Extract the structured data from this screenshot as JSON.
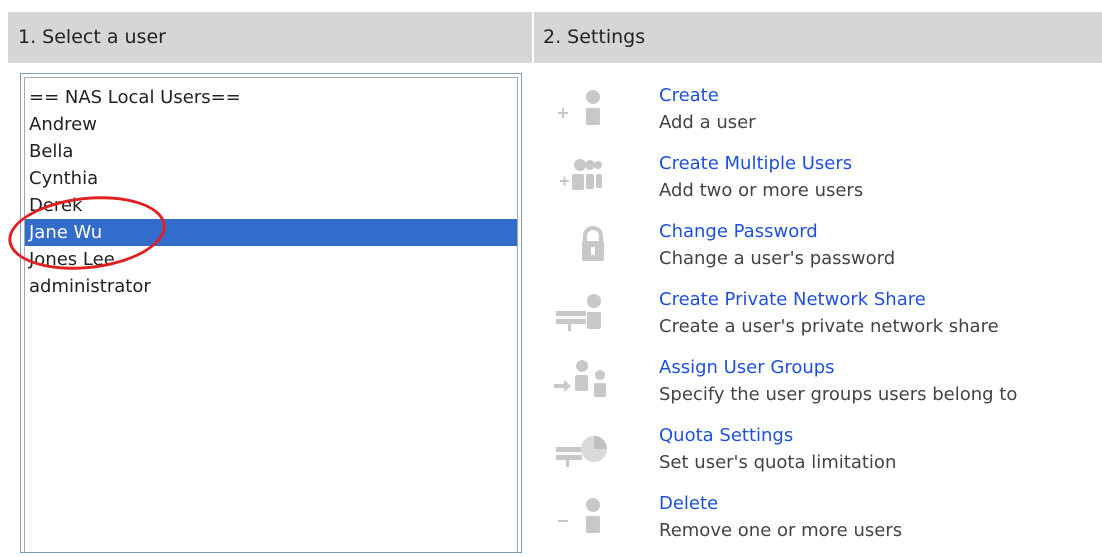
{
  "headers": {
    "select_user": "1. Select a user",
    "settings": "2. Settings"
  },
  "users": {
    "group_label": "== NAS Local Users==",
    "items": [
      "Andrew",
      "Bella",
      "Cynthia",
      "Derek",
      "Jane Wu",
      "Jones Lee",
      "administrator"
    ],
    "selected": "Jane Wu"
  },
  "actions": [
    {
      "title": "Create",
      "desc": "Add a user",
      "icon": "add-user-icon"
    },
    {
      "title": "Create Multiple Users",
      "desc": "Add two or more users",
      "icon": "add-multiple-users-icon"
    },
    {
      "title": "Change Password",
      "desc": "Change a user's password",
      "icon": "lock-icon"
    },
    {
      "title": "Create Private Network Share",
      "desc": "Create a user's private network share",
      "icon": "network-share-icon"
    },
    {
      "title": "Assign User Groups",
      "desc": "Specify the user groups users belong to",
      "icon": "user-groups-icon"
    },
    {
      "title": "Quota Settings",
      "desc": "Set user's quota limitation",
      "icon": "quota-icon"
    },
    {
      "title": "Delete",
      "desc": "Remove one or more users",
      "icon": "delete-user-icon"
    }
  ],
  "colors": {
    "header_bg": "#d6d6d6",
    "selection": "#336dcc",
    "link": "#1e50dc",
    "annotation": "#e02020",
    "icon_gray": "#c8c8c8"
  }
}
